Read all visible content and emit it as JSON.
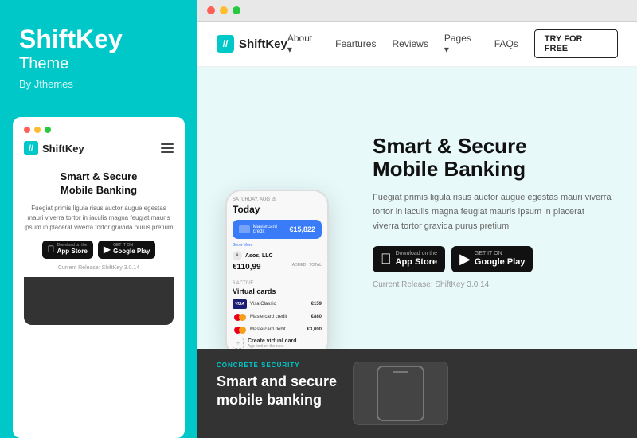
{
  "sidebar": {
    "title": "ShiftKey",
    "subtitle": "Theme",
    "by": "By Jthemes",
    "preview": {
      "logo": "ShiftKey",
      "hero_title": "Smart & Secure\nMobile Banking",
      "hero_text": "Fuegiat primis ligula risus auctor augue egestas mauri viverra tortor in iaculis magna feugiat mauris ipsum in placerat viverra tortor gravida purus pretium",
      "app_store_label_small": "Download on the",
      "app_store_label_big": "App Store",
      "google_play_label_small": "GET IT ON",
      "google_play_label_big": "Google Play",
      "release": "Current Release: ShiftKey 3.0.14"
    }
  },
  "browser": {
    "dots": [
      "red",
      "yellow",
      "green"
    ]
  },
  "website": {
    "logo": "ShiftKey",
    "nav": {
      "links": [
        "About ▾",
        "Feartures",
        "Reviews",
        "Pages ▾",
        "FAQs"
      ],
      "cta": "TRY FOR FREE"
    },
    "hero": {
      "heading": "Smart & Secure\nMobile Banking",
      "body": "Fuegiat primis ligula risus auctor augue egestas mauri viverra tortor in iaculis magna feugiat mauris ipsum in placerat viverra tortor gravida purus pretium",
      "app_store_small": "Download on the",
      "app_store_big": "App Store",
      "google_play_small": "GET IT ON",
      "google_play_big": "Google Play",
      "release": "Current Release: ShiftKey 3.0.14"
    },
    "phone": {
      "date": "SATURDAY, AUG 28",
      "today": "Today",
      "card_label": "Mastercard credit",
      "card_amount": "€15,822",
      "show_more": "Show More",
      "company": "Asos, LLC",
      "amount": "€110,99",
      "amount_labels": [
        "ADDED",
        "TOTAL"
      ],
      "section_count": "6 ACTIVE",
      "section_title": "Virtual cards",
      "cards": [
        {
          "type": "visa",
          "name": "Visa Classic",
          "amount": "€159"
        },
        {
          "type": "mc",
          "name": "Mastercard credit",
          "amount": "€880"
        },
        {
          "type": "mc",
          "name": "Mastercard debit",
          "amount": "€3,000"
        }
      ],
      "add_card": "Create virtual card",
      "add_card_sub": "App limit on the next"
    },
    "bottom": {
      "tag": "CONCRETE SECURITY",
      "heading": "Smart and secure\nmobile banking"
    }
  }
}
